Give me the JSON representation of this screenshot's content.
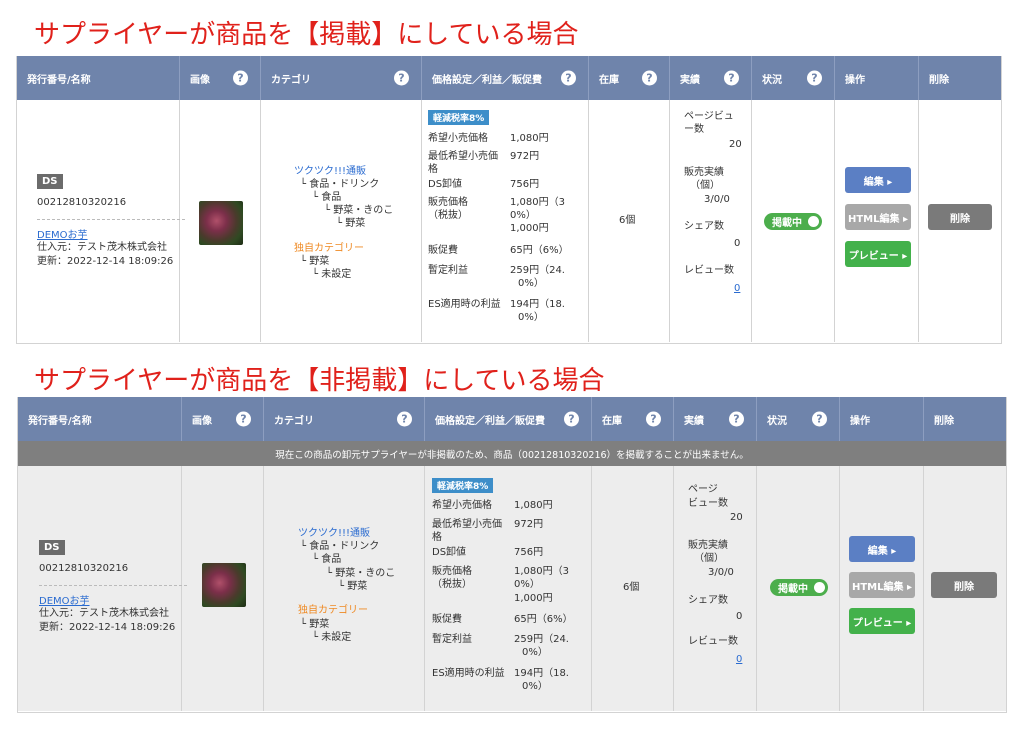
{
  "sections": [
    {
      "title": "サプライヤーが商品を【掲載】にしている場合"
    },
    {
      "title": "サプライヤーが商品を【非掲載】にしている場合",
      "notice": "現在この商品の卸元サプライヤーが非掲載のため、商品（00212810320216）を掲載することが出来ません。"
    }
  ],
  "headers": {
    "id_name": "発行番号/名称",
    "image": "画像",
    "category": "カテゴリ",
    "price": "価格設定／利益／販促費",
    "stock": "在庫",
    "results": "実績",
    "status": "状況",
    "ops": "操作",
    "delete": "削除",
    "help": "?"
  },
  "product": {
    "badge": "DS",
    "id": "00212810320216",
    "name": "DEMOお芋",
    "supplier": "仕入元：テスト茂木株式会社",
    "updated": "更新：2022-12-14 18:09:26"
  },
  "category": {
    "main_shop": "ツクツク!!!通販",
    "main_1": "└ 食品・ドリンク",
    "main_2": "└ 食品",
    "main_3": "└ 野菜・きのこ",
    "main_4": "└ 野菜",
    "own_title": "独自カテゴリー",
    "own_1": "└ 野菜",
    "own_2": "└ 未設定"
  },
  "price": {
    "tax_badge": "軽減税率8%",
    "retail_label": "希望小売価格",
    "retail_value": "1,080円",
    "min_retail_label_1": "最低希望小売価",
    "min_retail_label_2": "格",
    "min_retail_value": "972円",
    "ds_label": "DS卸値",
    "ds_value": "756円",
    "sell_label_1": "販売価格",
    "sell_label_2": "（税抜）",
    "sell_value_1": "1,080円（3",
    "sell_value_2": "0%）",
    "sell_value_3": "1,000円",
    "promo_label": "販促費",
    "promo_value": "65円（6%）",
    "profit_label": "暫定利益",
    "profit_value_1": "259円（24.",
    "profit_value_2": "0%）",
    "es_label": "ES適用時の利益",
    "es_value_1": "194円（18.",
    "es_value_2": "0%）"
  },
  "stock": "6個",
  "stats": {
    "pv_a_1": "ページビュ",
    "pv_a_2": "ー数",
    "pv_b_1": "ページ",
    "pv_b_2": "ビュー数",
    "pv_value": "20",
    "sales_1": "販売実績",
    "sales_2": "（個）",
    "sales_value": "3/0/0",
    "share_label": "シェア数",
    "share_value": "0",
    "review_label": "レビュー数",
    "review_value": "0"
  },
  "status_toggle": "掲載中",
  "buttons": {
    "edit": "編集 ▸",
    "html_edit": "HTML編集 ▸",
    "preview": "プレビュー ▸",
    "delete": "削除"
  },
  "colors": {
    "title_red": "#e0211b",
    "header_bg": "#6f84ab",
    "link_blue": "#2a6bd0",
    "own_category_orange": "#ef8a24",
    "toggle_green": "#4cae4c"
  }
}
